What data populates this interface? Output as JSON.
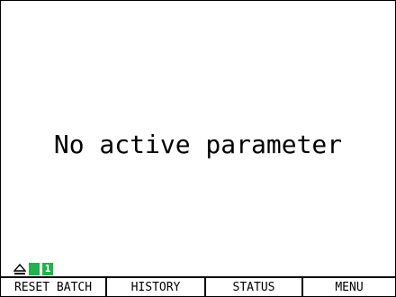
{
  "main": {
    "message": "No active parameter"
  },
  "status": {
    "icons": [
      "eject-icon",
      "green-block",
      "green-badge"
    ],
    "badge_value": "1",
    "accent_color": "#22b14c"
  },
  "softkeys": [
    {
      "label": "RESET BATCH"
    },
    {
      "label": "HISTORY"
    },
    {
      "label": "STATUS"
    },
    {
      "label": "MENU"
    }
  ]
}
